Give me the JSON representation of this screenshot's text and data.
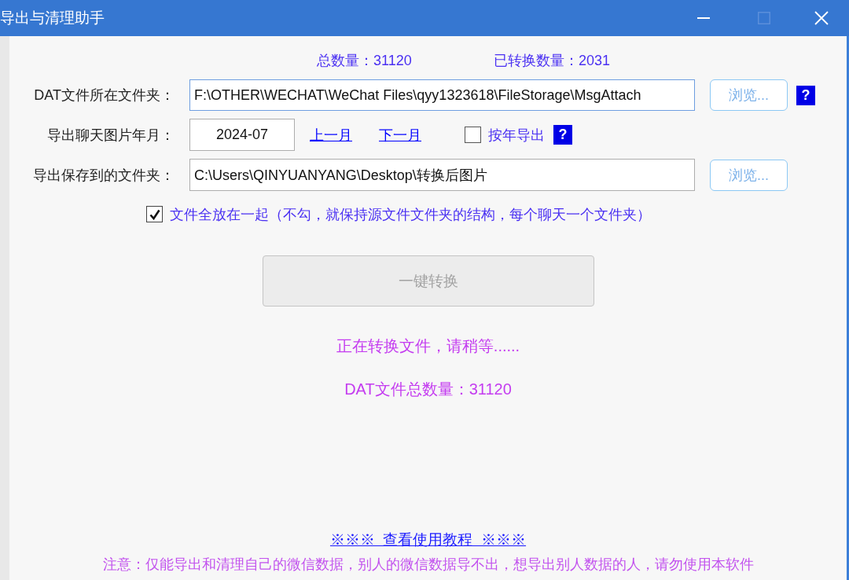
{
  "window": {
    "title": "导出与清理助手",
    "controls": [
      {
        "kind": "minimize",
        "disabled": false
      },
      {
        "kind": "maximize",
        "disabled": true
      },
      {
        "kind": "close",
        "disabled": false
      }
    ]
  },
  "stats": [
    "总数量：31120",
    "已转换数量：2031"
  ],
  "source_folder": {
    "label": "DAT文件所在文件夹：",
    "value": "F:\\OTHER\\WECHAT\\WeChat Files\\qyy1323618\\FileStorage\\MsgAttach",
    "focused": true,
    "browse": "浏览...",
    "help": "?"
  },
  "month": {
    "label": "导出聊天图片年月：",
    "value": "2024-07",
    "prev": "上一月",
    "next": "下一月",
    "by_year": {
      "label": "按年导出",
      "checked": false
    },
    "help": "?"
  },
  "output_folder": {
    "label": "导出保存到的文件夹：",
    "value": "C:\\Users\\QINYUANYANG\\Desktop\\转换后图片",
    "focused": false,
    "browse": "浏览..."
  },
  "flat_option": {
    "label": "文件全放在一起（不勾，就保持源文件文件夹的结构，每个聊天一个文件夹）",
    "checked": true
  },
  "convert_button": {
    "label": "一键转换",
    "disabled": true
  },
  "status_lines": [
    "正在转换文件，请稍等......",
    "DAT文件总数量：31120"
  ],
  "tutorial_link": "※※※  查看使用教程  ※※※",
  "notice": "注意：仅能导出和清理自己的微信数据，别人的微信数据导不出，想导出别人数据的人，请勿使用本软件"
}
